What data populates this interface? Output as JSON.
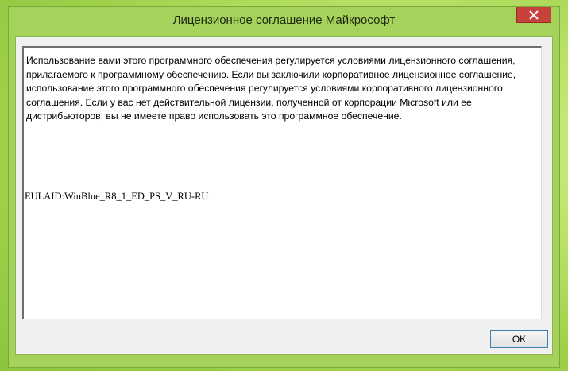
{
  "window": {
    "title": "Лицензионное соглашение Майкрософт",
    "close_icon": "close-icon"
  },
  "eula": {
    "text": "Использование вами этого программного обеспечения регулируется условиями лицензионного соглашения, прилагаемого к программному обеспечению. Если вы заключили корпоративное лицензионное соглашение, использование этого программного обеспечения регулируется условиями корпоративного лицензионного соглашения. Если у вас нет действительной лицензии, полученной от корпорации Microsoft или ее дистрибьюторов, вы не имеете право использовать это программное обеспечение.",
    "eula_id": "EULAID:WinBlue_R8_1_ED_PS_V_RU-RU"
  },
  "buttons": {
    "ok_label": "OK"
  },
  "colors": {
    "frame": "#a4d25a",
    "close_button": "#c7423a",
    "default_button_border": "#3c7fb1"
  }
}
